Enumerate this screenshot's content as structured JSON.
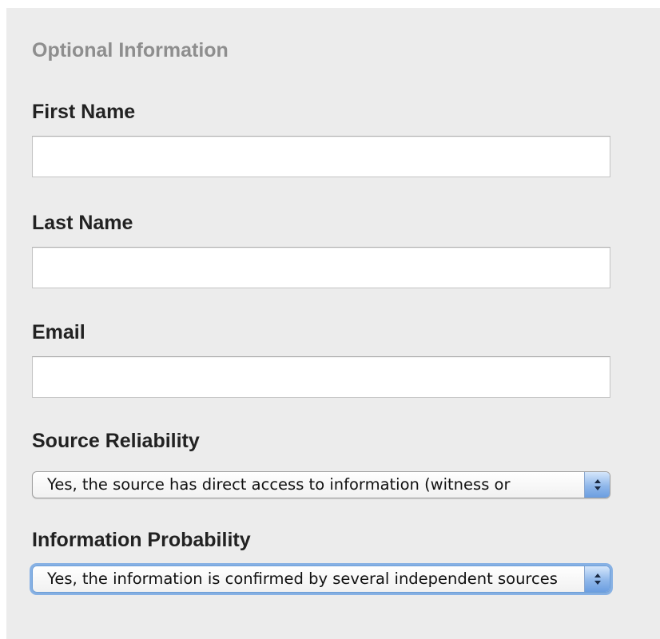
{
  "form": {
    "section_title": "Optional Information",
    "first_name": {
      "label": "First Name",
      "value": "",
      "placeholder": ""
    },
    "last_name": {
      "label": "Last Name",
      "value": "",
      "placeholder": ""
    },
    "email": {
      "label": "Email",
      "value": "",
      "placeholder": ""
    },
    "source_reliability": {
      "label": "Source Reliability",
      "selected": "Yes, the source has direct access to information (witness or"
    },
    "information_probability": {
      "label": "Information Probability",
      "selected": "Yes, the information is confirmed by several independent sources"
    }
  },
  "icons": {
    "select_arrows": "up-down-chevron-icon"
  },
  "colors": {
    "panel_background": "#ececec",
    "section_title": "#8e8e8e",
    "label": "#222222",
    "focus_ring": "#669ee2",
    "select_stepper": "#8fb7ea"
  }
}
